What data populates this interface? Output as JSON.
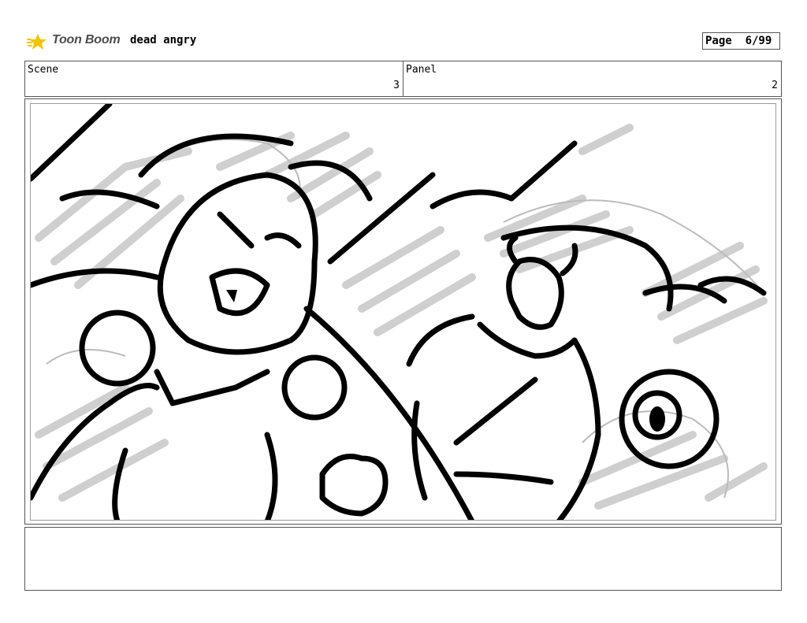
{
  "header": {
    "logo_text": "Toon Boom",
    "project_title": "dead angry",
    "page_label": "Page",
    "page_number": "6/99"
  },
  "scene": {
    "label": "Scene",
    "value": "3"
  },
  "panel": {
    "label": "Panel",
    "value": "2"
  },
  "panel_image": {
    "icon": "storyboard-sketch-image"
  },
  "notes": {
    "text": ""
  },
  "colors": {
    "logo_star": "#f5c400",
    "logo_text": "#4d4d4d",
    "border": "#555555",
    "sketch_fill": "#cfcfcf"
  }
}
